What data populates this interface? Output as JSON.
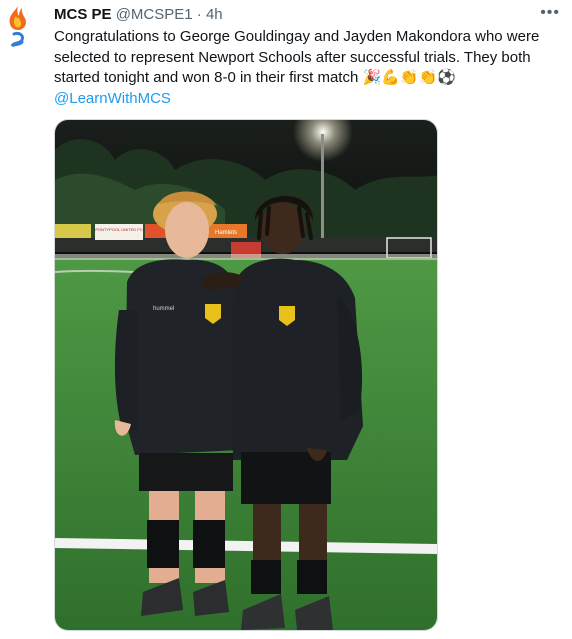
{
  "tweet": {
    "display_name": "MCS PE",
    "handle": "@MCSPE1",
    "separator": " · ",
    "time": "4h",
    "more_label": "•••",
    "text": "Congratulations to George Gouldingay and Jayden Makondora who were selected to represent Newport Schools after successful trials. They both started tonight and won 8-0 in their first match",
    "emojis": "🎉💪👏👏⚽",
    "mention": "@LearnWithMCS"
  },
  "media": {
    "banners": [
      "PONTYPOOL UNITED FC",
      "Hamlets"
    ],
    "shirt_brand": "hummel"
  },
  "colors": {
    "accent": "#1d9bf0",
    "muted": "#536471",
    "pitch": "#3f8a3a",
    "night_sky": "#0d1311"
  },
  "icons": {
    "avatar": "flame-logo-icon",
    "more": "more-options-icon"
  }
}
